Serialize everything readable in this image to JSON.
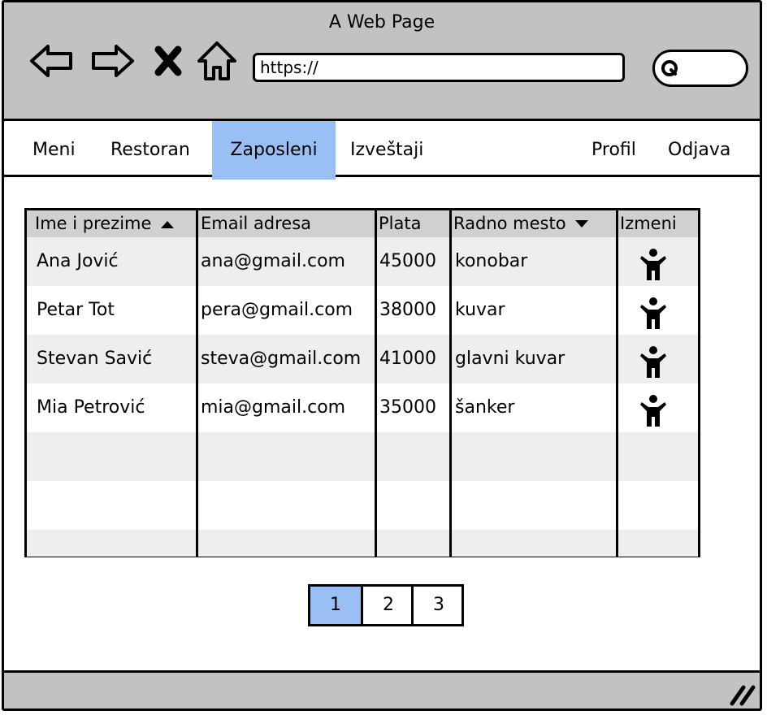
{
  "window": {
    "title": "A Web Page"
  },
  "browser": {
    "url_value": "https://",
    "icons": [
      "back-arrow-icon",
      "forward-arrow-icon",
      "close-x-icon",
      "home-icon",
      "search-icon"
    ]
  },
  "menu": {
    "items": [
      {
        "label": "Meni",
        "active": false
      },
      {
        "label": "Restoran",
        "active": false
      },
      {
        "label": "Zaposleni",
        "active": true
      },
      {
        "label": "Izveštaji",
        "active": false
      },
      {
        "label": "Profil",
        "active": false
      },
      {
        "label": "Odjava",
        "active": false
      }
    ],
    "active_color": "#99bff5"
  },
  "table": {
    "columns": [
      {
        "label": "Ime i prezime",
        "sort": "asc"
      },
      {
        "label": "Email adresa",
        "sort": ""
      },
      {
        "label": "Plata",
        "sort": ""
      },
      {
        "label": "Radno mesto",
        "sort": "desc"
      },
      {
        "label": "Izmeni",
        "sort": ""
      }
    ],
    "rows": [
      {
        "name": "Ana Jović",
        "email": "ana@gmail.com",
        "salary": "45000",
        "position": "konobar",
        "edit_icon": "person-icon"
      },
      {
        "name": "Petar Tot",
        "email": "pera@gmail.com",
        "salary": "38000",
        "position": "kuvar",
        "edit_icon": "person-icon"
      },
      {
        "name": "Stevan Savić",
        "email": "steva@gmail.com",
        "salary": "41000",
        "position": "glavni kuvar",
        "edit_icon": "person-icon"
      },
      {
        "name": "Mia Petrović",
        "email": "mia@gmail.com",
        "salary": "35000",
        "position": "šanker",
        "edit_icon": "person-icon"
      }
    ]
  },
  "pagination": {
    "pages": [
      "1",
      "2",
      "3"
    ],
    "current": "1"
  },
  "colors": {
    "chrome_gray": "#c2c2c2",
    "header_gray": "#d0d0d0",
    "row_shade": "#eeeeee",
    "accent_blue": "#99bff5"
  }
}
